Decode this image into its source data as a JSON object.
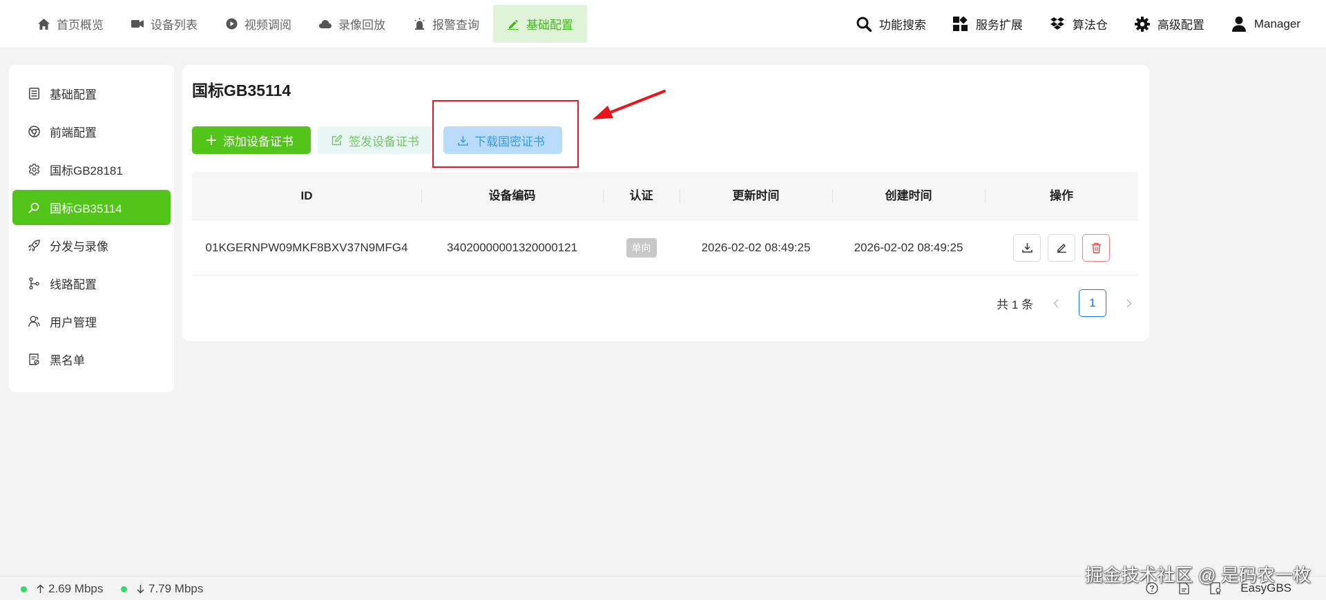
{
  "nav": {
    "left": [
      {
        "label": "首页概览",
        "icon": "home-icon"
      },
      {
        "label": "设备列表",
        "icon": "camera-icon"
      },
      {
        "label": "视频调阅",
        "icon": "play-icon"
      },
      {
        "label": "录像回放",
        "icon": "cloud-icon"
      },
      {
        "label": "报警查询",
        "icon": "alarm-icon"
      },
      {
        "label": "基础配置",
        "icon": "edit-icon"
      }
    ],
    "active_index": 5,
    "right": [
      {
        "label": "功能搜索",
        "icon": "search-icon"
      },
      {
        "label": "服务扩展",
        "icon": "grid-icon"
      },
      {
        "label": "算法仓",
        "icon": "dropbox-icon"
      },
      {
        "label": "高级配置",
        "icon": "gear-icon"
      },
      {
        "label": "Manager",
        "icon": "user-icon"
      }
    ]
  },
  "sidebar": {
    "items": [
      {
        "label": "基础配置",
        "icon": "list-icon"
      },
      {
        "label": "前端配置",
        "icon": "chrome-icon"
      },
      {
        "label": "国标GB28181",
        "icon": "settings-icon"
      },
      {
        "label": "国标GB35114",
        "icon": "search-icon"
      },
      {
        "label": "分发与录像",
        "icon": "rocket-icon"
      },
      {
        "label": "线路配置",
        "icon": "branch-icon"
      },
      {
        "label": "用户管理",
        "icon": "users-icon"
      },
      {
        "label": "黑名单",
        "icon": "blacklist-icon"
      }
    ],
    "active_index": 3
  },
  "main": {
    "title": "国标GB35114",
    "buttons": {
      "add": "添加设备证书",
      "sign": "签发设备证书",
      "download": "下载国密证书"
    },
    "table": {
      "headers": [
        "ID",
        "设备编码",
        "认证",
        "更新时间",
        "创建时间",
        "操作"
      ],
      "rows": [
        {
          "id": "01KGERNPW09MKF8BXV37N9MFG4",
          "device_code": "34020000001320000121",
          "auth": "单向",
          "updated": "2026-02-02 08:49:25",
          "created": "2026-02-02 08:49:25"
        }
      ]
    },
    "pagination": {
      "total_text": "共 1 条",
      "current_page": "1"
    }
  },
  "status": {
    "upload": "2.69 Mbps",
    "download": "7.79 Mbps",
    "brand": "EasyGBS",
    "watermark": "掘金技术社区 @ 是码农一枚"
  },
  "colors": {
    "accent": "#52c41a",
    "highlight": "#e8151b",
    "link": "#1677ff"
  }
}
